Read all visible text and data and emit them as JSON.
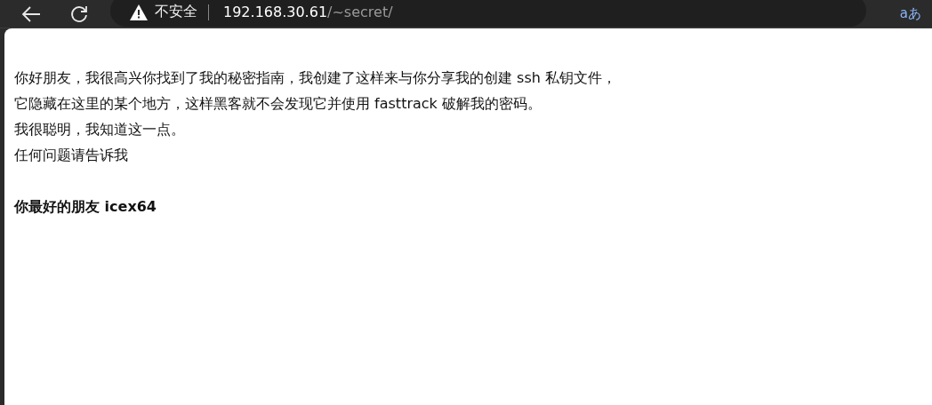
{
  "toolbar": {
    "security_label": "不安全",
    "host": "192.168.30.61",
    "path": "/~secret/",
    "translate_glyph": "aあ"
  },
  "page": {
    "lines": [
      "你好朋友，我很高兴你找到了我的秘密指南，我创建了这样来与你分享我的创建 ssh 私钥文件，",
      "它隐藏在这里的某个地方，这样黑客就不会发现它并使用 fasttrack 破解我的密码。",
      "我很聪明，我知道这一点。",
      "任何问题请告诉我"
    ],
    "signature": "你最好的朋友 icex64"
  }
}
